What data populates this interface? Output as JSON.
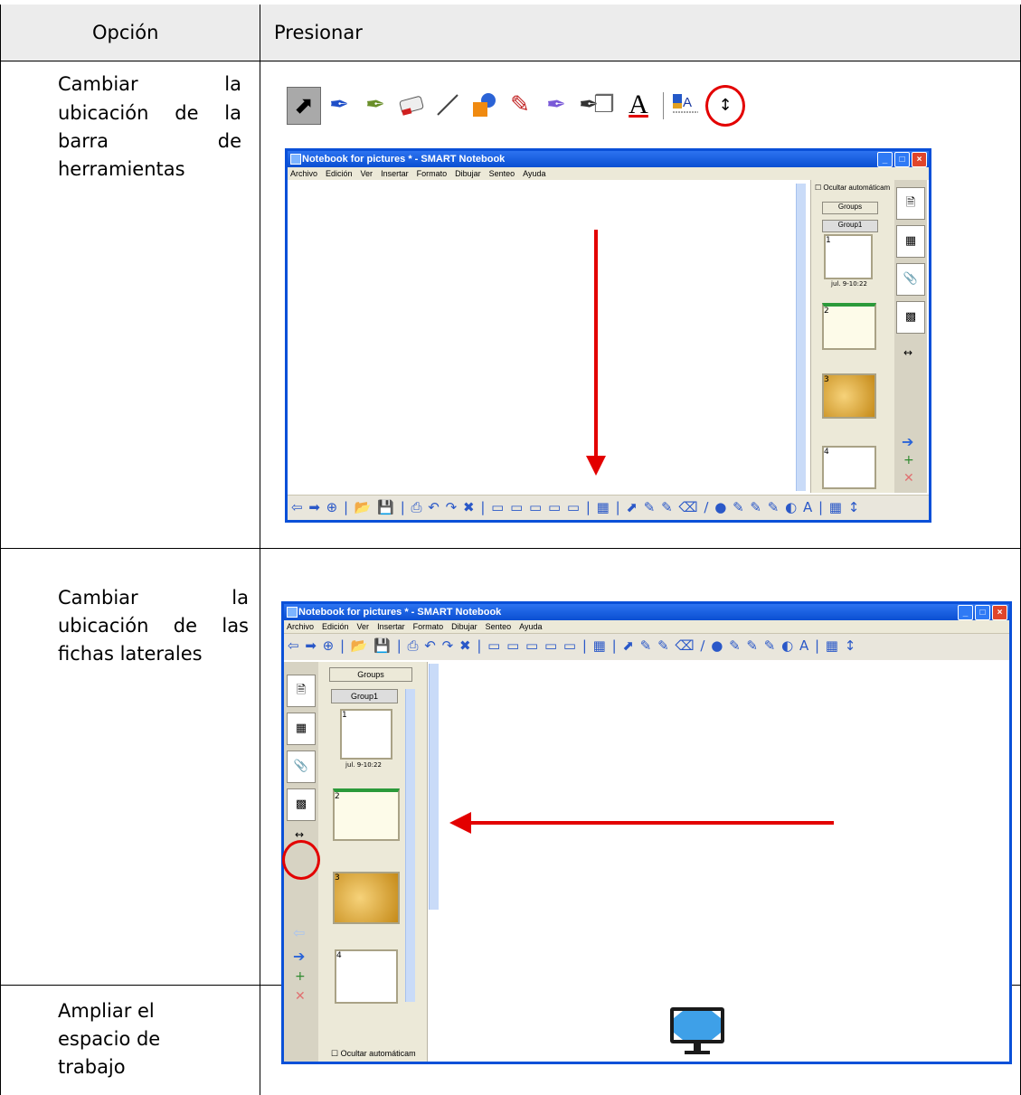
{
  "table": {
    "header": {
      "col1": "Opción",
      "col2": "Presionar"
    },
    "rows": [
      {
        "line1": [
          "Cambiar",
          "la"
        ],
        "line2": "ubicación de la",
        "line3": [
          "barra",
          "de"
        ],
        "line4": "herramientas"
      },
      {
        "line1": [
          "Cambiar",
          "la"
        ],
        "line2": "ubicación de las",
        "line3": "fichas laterales"
      },
      {
        "line1": "Ampliar el",
        "line2": "espacio de",
        "line3": "trabajo"
      }
    ]
  },
  "toolbar_icons": [
    "select-arrow-icon",
    "pen-icon",
    "creative-pen-icon",
    "eraser-icon",
    "line-icon",
    "shapes-icon",
    "shape-recognition-pen-icon",
    "magic-pen-icon",
    "fill-icon",
    "text-icon",
    "properties-icon",
    "move-toolbar-icon"
  ],
  "window1": {
    "title": "Notebook for pictures * - SMART Notebook",
    "menu": [
      "Archivo",
      "Edición",
      "Ver",
      "Insertar",
      "Formato",
      "Dibujar",
      "Senteo",
      "Ayuda"
    ],
    "autohide_label": "Ocultar automáticam",
    "groups_button": "Groups",
    "group_label": "Group1",
    "thumb_date": "jul. 9-10:22",
    "thumbs": [
      "1",
      "2",
      "3",
      "4"
    ]
  },
  "window2": {
    "title": "Notebook for pictures * - SMART Notebook",
    "menu": [
      "Archivo",
      "Edición",
      "Ver",
      "Insertar",
      "Formato",
      "Dibujar",
      "Senteo",
      "Ayuda"
    ],
    "autohide_label": "Ocultar automáticam",
    "groups_button": "Groups",
    "group_label": "Group1",
    "thumb_date": "jul. 9-10:22",
    "thumbs": [
      "1",
      "2",
      "3",
      "4"
    ]
  },
  "colors": {
    "highlight": "#e30000",
    "titlebar": "#0a50d8"
  },
  "monitor_icon": "full-screen-monitor-icon"
}
